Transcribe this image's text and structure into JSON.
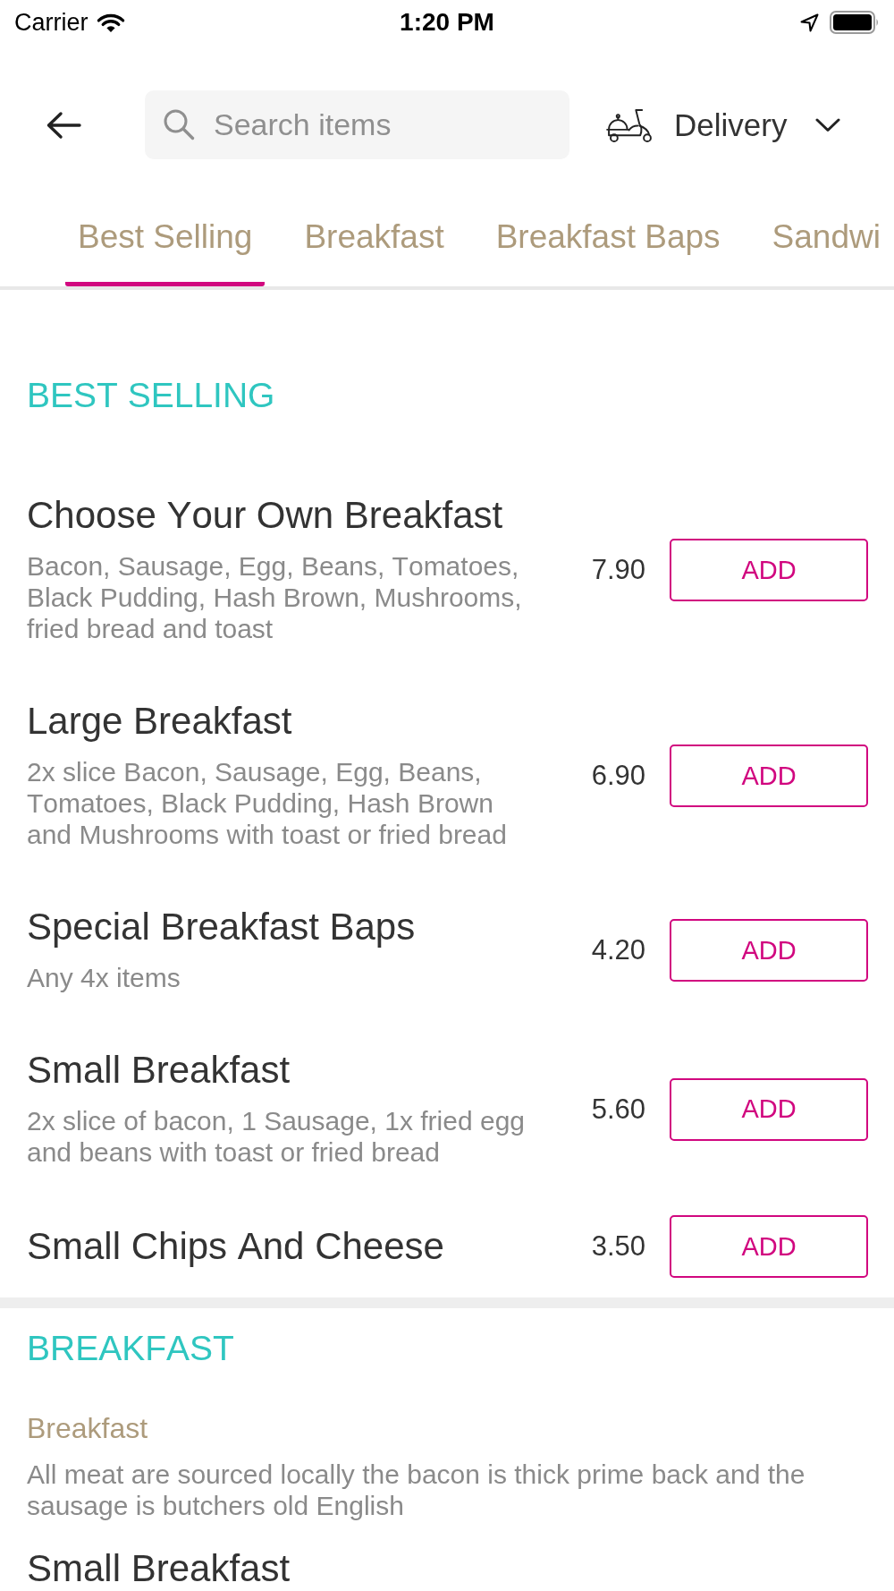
{
  "status_bar": {
    "carrier": "Carrier",
    "time": "1:20 PM"
  },
  "header": {
    "search": {
      "placeholder": "Search items"
    },
    "fulfilment": {
      "label": "Delivery"
    }
  },
  "tabs": [
    {
      "label": "Best Selling",
      "selected": true
    },
    {
      "label": "Breakfast",
      "selected": false
    },
    {
      "label": "Breakfast Baps",
      "selected": false
    },
    {
      "label": "Sandwi",
      "selected": false
    }
  ],
  "sections": [
    {
      "heading": "BEST SELLING",
      "items": [
        {
          "name": "Choose Your Own Breakfast",
          "description": "Bacon, Sausage, Egg, Beans, Tomatoes, Black Pudding, Hash Brown, Mushrooms, fried bread and toast",
          "price": "7.90",
          "button": "ADD"
        },
        {
          "name": "Large Breakfast",
          "description": "2x slice Bacon, Sausage, Egg, Beans, Tomatoes, Black Pudding, Hash Brown and Mushrooms with toast or fried bread",
          "price": "6.90",
          "button": "ADD"
        },
        {
          "name": "Special Breakfast Baps",
          "description": "Any 4x items",
          "price": "4.20",
          "button": "ADD"
        },
        {
          "name": "Small Breakfast",
          "description": "2x slice of bacon, 1 Sausage, 1x fried egg and beans with toast or fried bread",
          "price": "5.60",
          "button": "ADD"
        },
        {
          "name": "Small Chips And Cheese",
          "price": "3.50",
          "button": "ADD"
        }
      ]
    },
    {
      "heading": "BREAKFAST",
      "category": {
        "name": "Breakfast",
        "description": "All meat are sourced locally the bacon is thick prime back and the sausage is butchers old English"
      },
      "items": [
        {
          "name": "Small Breakfast"
        }
      ]
    }
  ]
}
